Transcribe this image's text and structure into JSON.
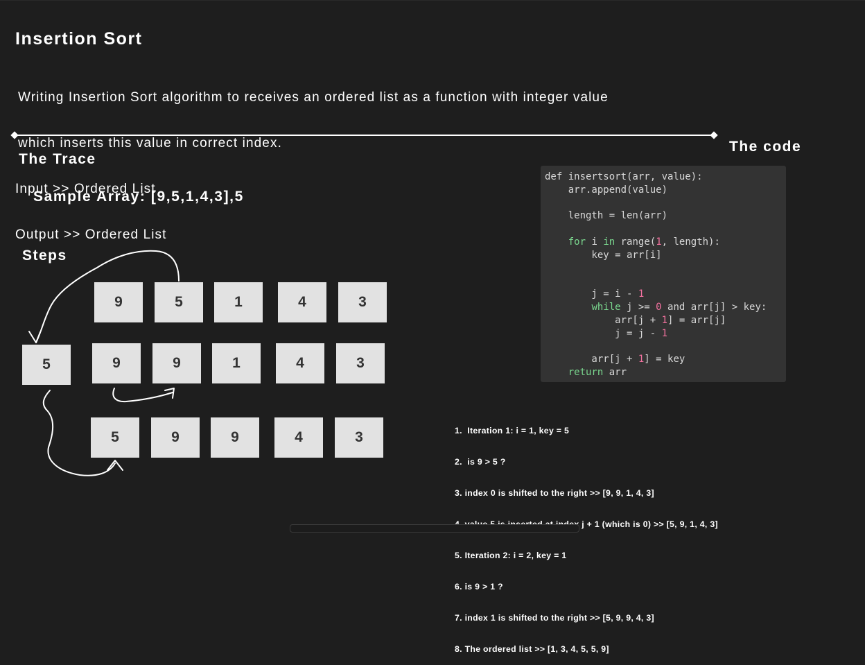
{
  "title": "Insertion Sort",
  "description": {
    "line1": "Writing Insertion Sort algorithm to receives an ordered list as a function with integer value",
    "line2": "which inserts this value in correct index.",
    "line3": "Input >> Ordered List",
    "line4": "Output >> Ordered List"
  },
  "trace_heading": "The Trace",
  "code_heading": "The code",
  "sample_array": "Sample Array: [9,5,1,4,3],5",
  "steps_heading": "Steps",
  "rows": {
    "row1": [
      "9",
      "5",
      "1",
      "4",
      "3"
    ],
    "key": "5",
    "row2": [
      "9",
      "9",
      "1",
      "4",
      "3"
    ],
    "row3": [
      "5",
      "9",
      "9",
      "4",
      "3"
    ]
  },
  "code": {
    "l1": "def insertsort(arr, value):",
    "l2": "    arr.append(value)",
    "l4a": "    length = len(arr)",
    "l6_kw1": "for",
    "l6_mid": " i ",
    "l6_kw2": "in",
    "l6_a": " range(",
    "l6_num": "1",
    "l6_b": ", length):",
    "l7": "        key = arr[i]",
    "l10_a": "        j = i - ",
    "l10_num": "1",
    "l11_kw": "while",
    "l11_a": " j >= ",
    "l11_num": "0",
    "l11_b": " and arr[j] > key:",
    "l12_a": "            arr[j + ",
    "l12_num": "1",
    "l12_b": "] = arr[j]",
    "l13_a": "            j = j - ",
    "l13_num": "1",
    "l15_a": "        arr[j + ",
    "l15_num": "1",
    "l15_b": "] = key",
    "l16_kw": "return",
    "l16_b": " arr"
  },
  "notes": [
    "1.  Iteration 1: i = 1, key = 5",
    "2.  is 9 > 5 ?",
    "3. index 0 is shifted to the right >> [9, 9, 1, 4, 3]",
    "4. value 5 is inserted at index j + 1 (which is 0) >> [5, 9, 1, 4, 3]",
    "5. Iteration 2: i = 2, key = 1",
    "6. is 9 > 1 ?",
    "7. index 1 is shifted to the right >> [5, 9, 9, 4, 3]",
    "8. The ordered list >> [1, 3, 4, 5, 5, 9]"
  ],
  "colors": {
    "background": "#1e1e1e",
    "box": "#e2e2e2",
    "code_panel": "#333333",
    "keyword": "#7bd88f",
    "number": "#f472a0"
  }
}
